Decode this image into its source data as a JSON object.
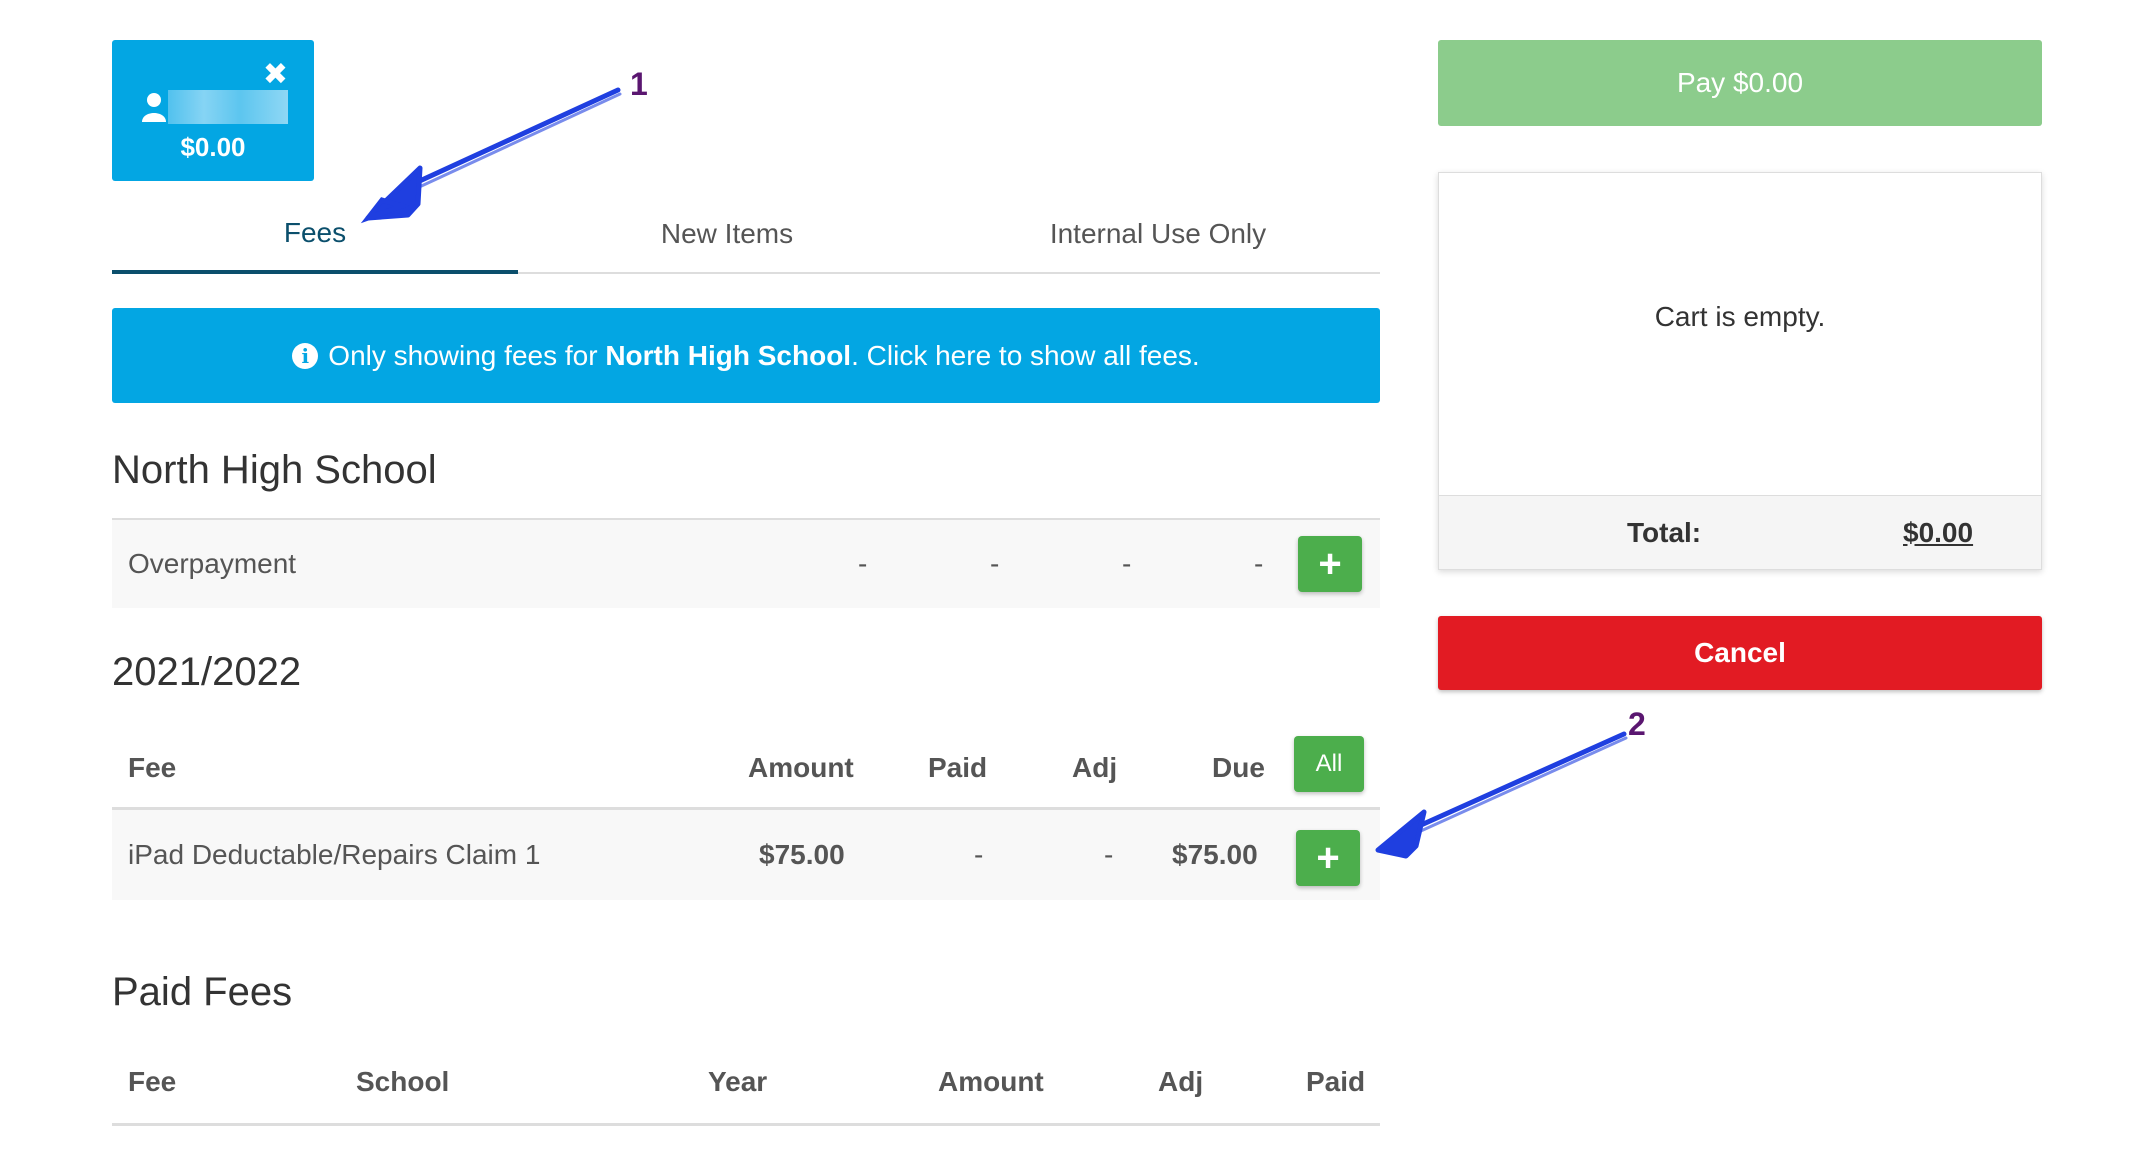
{
  "student_chip": {
    "amount": "$0.00",
    "close_glyph": "✖"
  },
  "tabs": [
    {
      "label": "Fees",
      "active": true
    },
    {
      "label": "New Items",
      "active": false
    },
    {
      "label": "Internal Use Only",
      "active": false
    }
  ],
  "info_banner": {
    "icon_glyph": "i",
    "text_before": "Only showing fees for ",
    "school_name": "North High School",
    "text_after": ". Click here to show all fees."
  },
  "school_section": {
    "title": "North High School",
    "rows": [
      {
        "fee": "Overpayment",
        "amount": "-",
        "paid": "-",
        "adj": "-",
        "due": "-",
        "add_glyph": "+"
      }
    ]
  },
  "year_section": {
    "title": "2021/2022",
    "headers": {
      "fee": "Fee",
      "amount": "Amount",
      "paid": "Paid",
      "adj": "Adj",
      "due": "Due",
      "all_button": "All"
    },
    "rows": [
      {
        "fee": "iPad Deductable/Repairs Claim 1",
        "amount": "$75.00",
        "paid": "-",
        "adj": "-",
        "due": "$75.00",
        "add_glyph": "+"
      }
    ]
  },
  "paid_fees": {
    "title": "Paid Fees",
    "headers": {
      "fee": "Fee",
      "school": "School",
      "year": "Year",
      "amount": "Amount",
      "adj": "Adj",
      "paid": "Paid"
    }
  },
  "cart": {
    "pay_button": "Pay $0.00",
    "empty_message": "Cart is empty.",
    "total_label": "Total:",
    "total_value": "$0.00",
    "cancel_button": "Cancel"
  },
  "annotations": {
    "first": "1",
    "second": "2"
  },
  "colors": {
    "primary_blue": "#03a6e3",
    "active_tab": "#0b4f6c",
    "green": "#4cae4c",
    "pay_green": "#8ccc8c",
    "cancel_red": "#e21b23",
    "annotation_arrow": "#1f3fe0",
    "annotation_number": "#5a1670"
  }
}
